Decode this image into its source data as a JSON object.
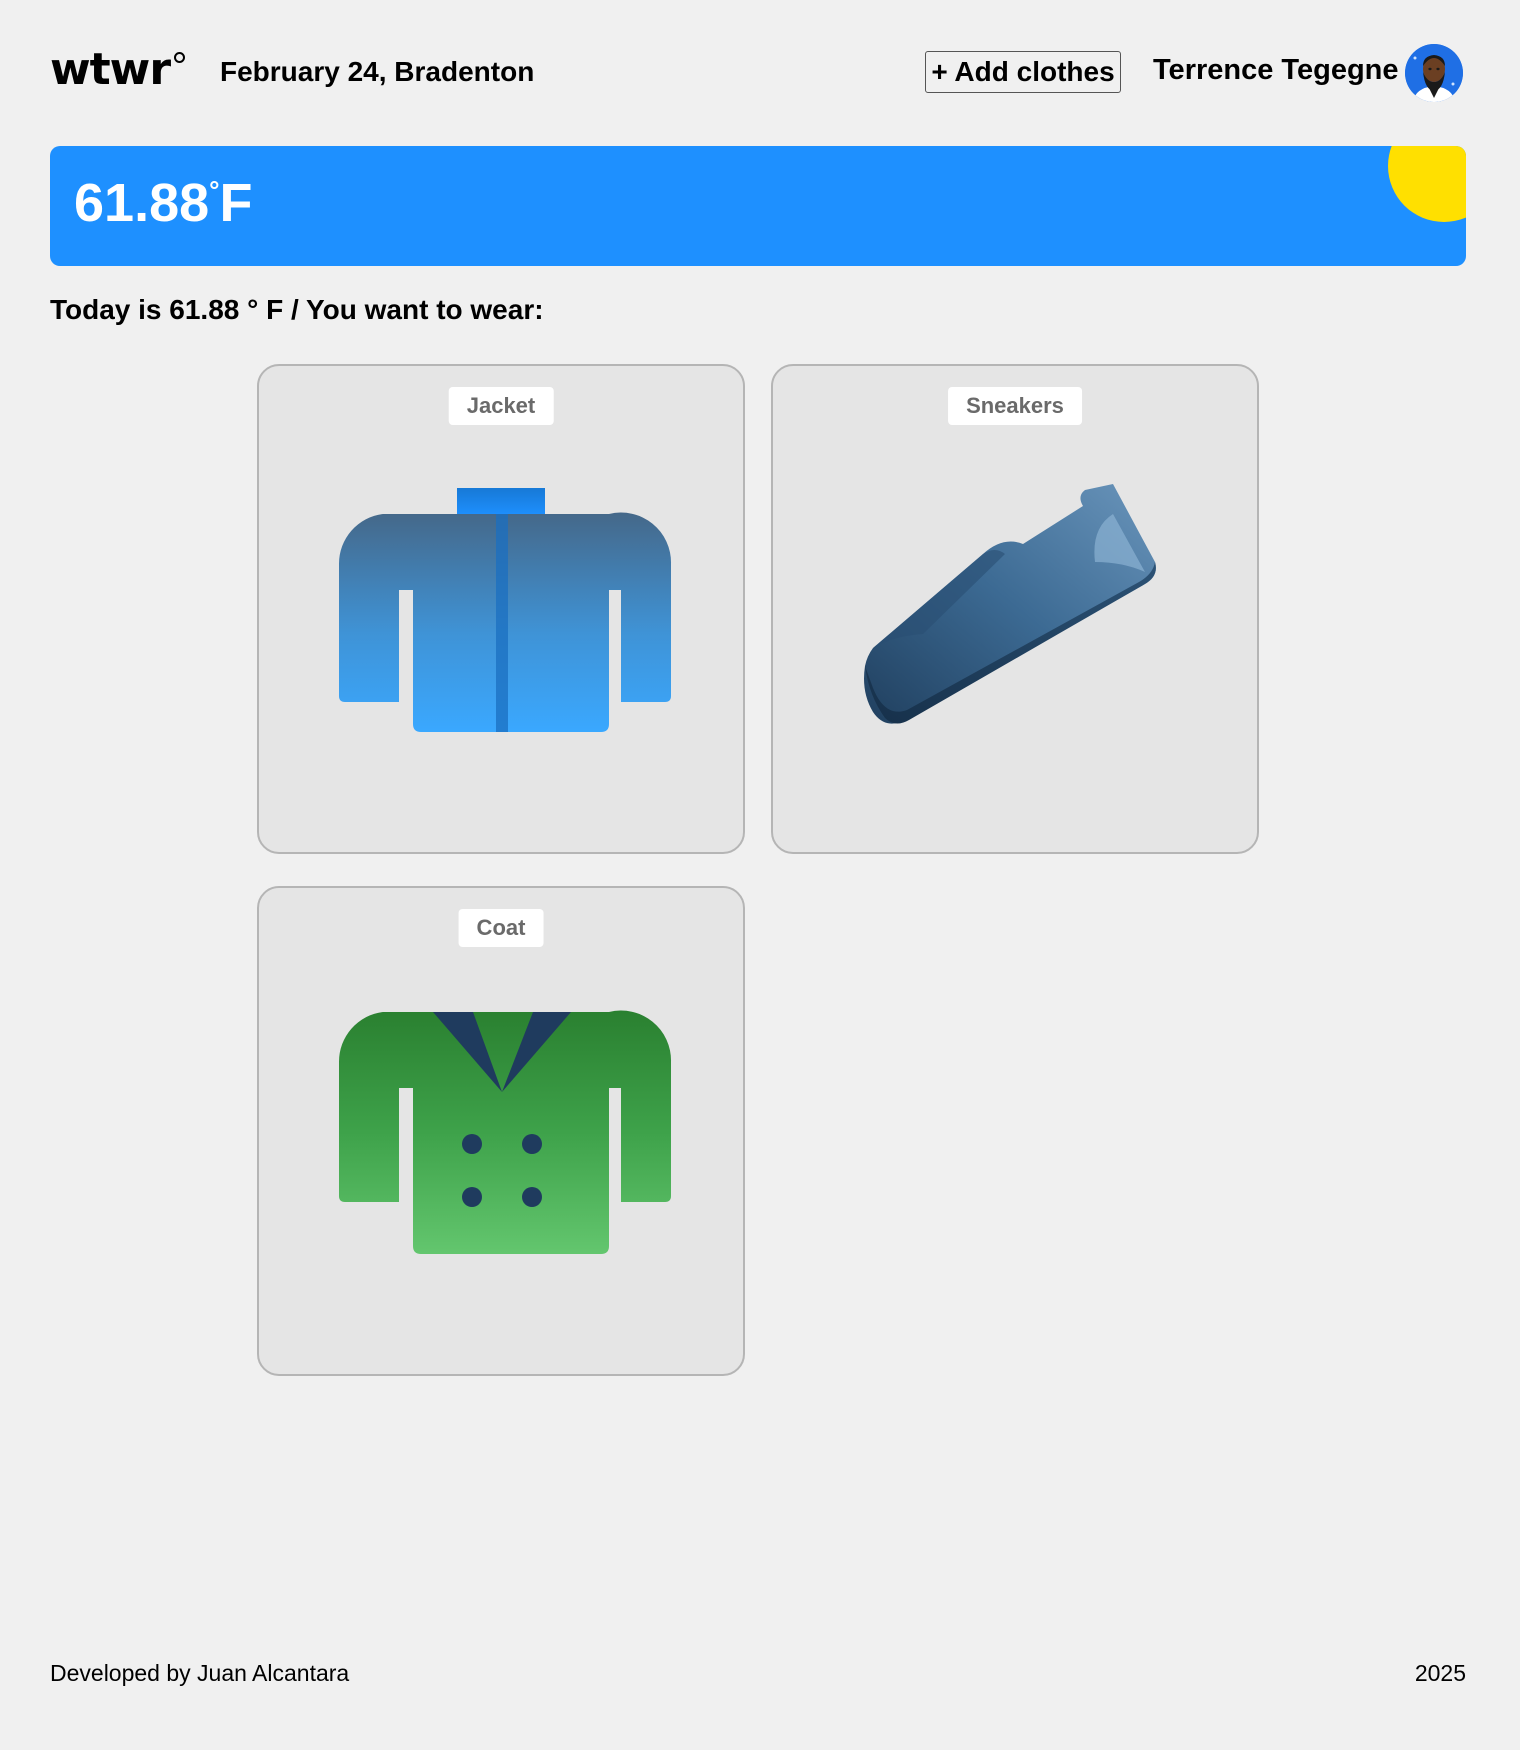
{
  "header": {
    "logo": "wtwr",
    "date_location": "February 24, Bradenton",
    "add_button_label": "+ Add clothes",
    "user_name": "Terrence Tegegne"
  },
  "weather": {
    "temperature": "61.88",
    "unit_symbol": "°",
    "unit": "F",
    "banner_color": "#1e90ff",
    "sun_color": "#ffe000"
  },
  "recommendation": {
    "text": "Today is 61.88 ° F / You want to wear:"
  },
  "items": [
    {
      "name": "Jacket",
      "icon": "jacket-icon"
    },
    {
      "name": "Sneakers",
      "icon": "sneaker-icon"
    },
    {
      "name": "Coat",
      "icon": "coat-icon"
    }
  ],
  "footer": {
    "credit": "Developed by Juan Alcantara",
    "year": "2025"
  }
}
